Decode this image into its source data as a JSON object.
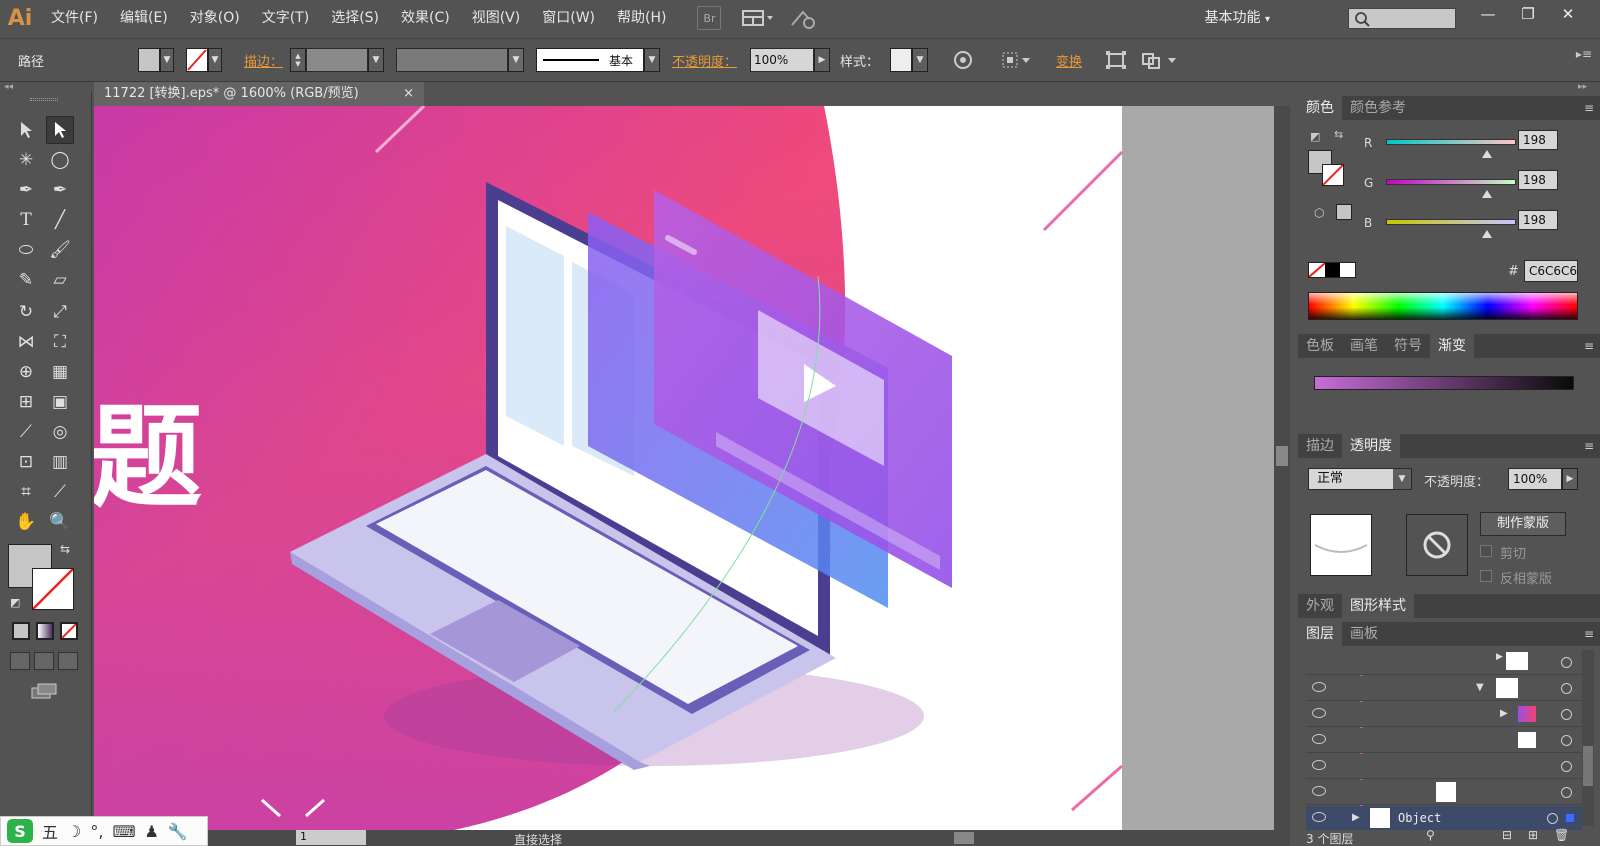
{
  "app": {
    "logo": "Ai",
    "workspace": "基本功能",
    "search_placeholder": ""
  },
  "menu": [
    "文件(F)",
    "编辑(E)",
    "对象(O)",
    "文字(T)",
    "选择(S)",
    "效果(C)",
    "视图(V)",
    "窗口(W)",
    "帮助(H)"
  ],
  "menubar_icons": {
    "bridge": "Br",
    "arrange": "arrange-docs-icon",
    "gpu": "gpu-performance-icon"
  },
  "window_controls": {
    "minimize": "—",
    "restore": "❐",
    "close": "✕"
  },
  "control_bar": {
    "selection_type": "路径",
    "stroke_label": "描边：",
    "stroke_profile": "基本",
    "opacity_label": "不透明度：",
    "opacity_value": "100%",
    "style_label": "样式：",
    "transform_label": "变换"
  },
  "document": {
    "tab_title": "11722 [转换].eps* @ 1600% (RGB/预览)",
    "close": "×",
    "zoom": "1600%",
    "status": "直接选择",
    "page_num": "1"
  },
  "canvas_art": {
    "visible_text": "题",
    "pink": "#f04575",
    "magenta": "#c43fb3",
    "purple": "#9b4ee0"
  },
  "color_panel": {
    "tabs": [
      "颜色",
      "颜色参考"
    ],
    "r_label": "R",
    "g_label": "G",
    "b_label": "B",
    "r": "198",
    "g": "198",
    "b": "198",
    "r_fraction": 0.776,
    "g_fraction": 0.776,
    "b_fraction": 0.776,
    "hash": "#",
    "hex": "C6C6C6",
    "fill": "#c6c6c6"
  },
  "gradient_panel": {
    "tabs": [
      "色板",
      "画笔",
      "符号",
      "渐变"
    ],
    "gradient_start": "#c66dd8",
    "gradient_end": "#0a0a0a"
  },
  "transparency_panel": {
    "tabs": [
      "描边",
      "透明度"
    ],
    "blend_mode": "正常",
    "opacity_label": "不透明度：",
    "opacity_value": "100%",
    "make_mask": "制作蒙版",
    "clip": "剪切",
    "invert_mask": "反相蒙版"
  },
  "appearance_panel": {
    "tabs": [
      "外观",
      "图形样式"
    ]
  },
  "layers_panel": {
    "tabs": [
      "图层",
      "画板"
    ],
    "layer_name": "Object",
    "count": "3 个图层"
  },
  "ime": {
    "mode": "五",
    "moon": "☽",
    "punct": "°,",
    "keyboard": "⌨",
    "person": "♟",
    "wrench": "🔧"
  }
}
